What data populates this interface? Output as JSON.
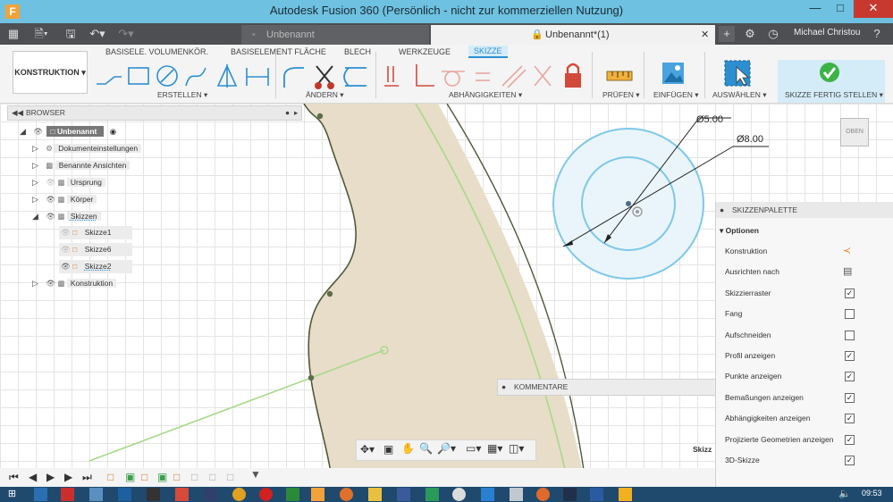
{
  "app": {
    "title": "Autodesk Fusion 360 (Persönlich - nicht zur kommerziellen Nutzung)",
    "icon_letter": "F"
  },
  "window_buttons": {
    "minimize": "—",
    "maximize": "□",
    "close": "✕"
  },
  "tabs": {
    "doc1": "Unbenannt",
    "doc2": "Unbenannt*(1)",
    "user": "Michael Christou"
  },
  "ribbon": {
    "workspace": "KONSTRUKTION",
    "tabs": [
      "BASISELE. VOLUMENKÖR.",
      "BASISELEMENT FLÄCHE",
      "BLECH",
      "WERKZEUGE",
      "SKIZZE"
    ],
    "groups": {
      "erstellen": "ERSTELLEN ▾",
      "aendern": "ÄNDERN ▾",
      "abhaengigkeiten": "ABHÄNGIGKEITEN ▾",
      "pruefen": "PRÜFEN ▾",
      "einfuegen": "EINFÜGEN ▾",
      "auswaehlen": "AUSWÄHLEN ▾",
      "fertig": "SKIZZE FERTIG STELLEN ▾"
    }
  },
  "browser": {
    "title": "BROWSER",
    "items": [
      {
        "label": "Unbenannt"
      },
      {
        "label": "Dokumenteinstellungen"
      },
      {
        "label": "Benannte Ansichten"
      },
      {
        "label": "Ursprung"
      },
      {
        "label": "Körper"
      },
      {
        "label": "Skizzen"
      },
      {
        "label": "Skizze1"
      },
      {
        "label": "Skizze6"
      },
      {
        "label": "Skizze2"
      },
      {
        "label": "Konstruktion"
      }
    ]
  },
  "dimensions": {
    "d1": "Ø5.00",
    "d2": "Ø8.00"
  },
  "view_cube": "OBEN",
  "comments": "KOMMENTARE",
  "palette": {
    "title": "SKIZZENPALETTE",
    "section": "Optionen",
    "rows": [
      {
        "label": "Konstruktion",
        "checked": null
      },
      {
        "label": "Ausrichten nach",
        "checked": null
      },
      {
        "label": "Skizzierraster",
        "checked": true
      },
      {
        "label": "Fang",
        "checked": false
      },
      {
        "label": "Aufschneiden",
        "checked": false
      },
      {
        "label": "Profil anzeigen",
        "checked": true
      },
      {
        "label": "Punkte anzeigen",
        "checked": true
      },
      {
        "label": "Bemaßungen anzeigen",
        "checked": true
      },
      {
        "label": "Abhängigkeiten anzeigen",
        "checked": true
      },
      {
        "label": "Projizierte Geometrien anzeigen",
        "checked": true
      },
      {
        "label": "3D-Skizze",
        "checked": true
      }
    ]
  },
  "partial_label": "Skizz",
  "check_glyph": "✓",
  "clock": "09:53",
  "colors": {
    "titlebar": "#6ec1e0",
    "accent": "#2d8fd0",
    "profile_fill": "#e8ddc8",
    "construction": "#a8d98a"
  }
}
